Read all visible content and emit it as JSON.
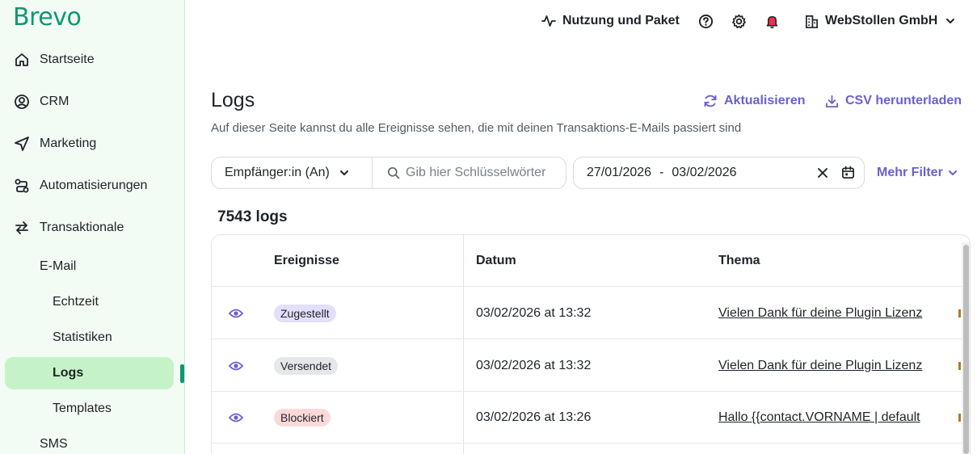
{
  "brand": {
    "logo_text": "Brevo",
    "accent": "#0b996e"
  },
  "sidebar": {
    "items": [
      {
        "label": "Startseite",
        "icon": "home-icon"
      },
      {
        "label": "CRM",
        "icon": "user-circle-icon"
      },
      {
        "label": "Marketing",
        "icon": "send-icon"
      },
      {
        "label": "Automatisierungen",
        "icon": "workflow-icon"
      },
      {
        "label": "Transaktionale",
        "icon": "swap-arrows-icon"
      }
    ],
    "sub": {
      "label": "E-Mail"
    },
    "sub2": [
      {
        "label": "Echtzeit"
      },
      {
        "label": "Statistiken"
      },
      {
        "label": "Logs",
        "active": true
      },
      {
        "label": "Templates"
      }
    ],
    "sms": {
      "label": "SMS"
    }
  },
  "topbar": {
    "usage_label": "Nutzung und Paket",
    "company_label": "WebStollen GmbH"
  },
  "page": {
    "title": "Logs",
    "description": "Auf dieser Seite kannst du alle Ereignisse sehen, die mit deinen Transaktions-E-Mails passiert sind",
    "refresh_label": "Aktualisieren",
    "csv_label": "CSV herunterladen",
    "accent": "#6b5fd3"
  },
  "filters": {
    "recipient_label": "Empfänger:in (An)",
    "search_placeholder": "Gib hier Schlüsselwörter",
    "date_from": "27/01/2026",
    "date_sep": "-",
    "date_to": "03/02/2026",
    "more_label": "Mehr Filter"
  },
  "logs_count": "7543 logs",
  "table": {
    "headers": {
      "events": "Ereignisse",
      "date": "Datum",
      "subject": "Thema"
    },
    "rows": [
      {
        "event": "Zugestellt",
        "event_color": "#e3defa",
        "date": "03/02/2026 at 13:32",
        "subject": "Vielen Dank für deine Plugin Lizenz"
      },
      {
        "event": "Versendet",
        "event_color": "#e6e7e9",
        "date": "03/02/2026 at 13:32",
        "subject": "Vielen Dank für deine Plugin Lizenz"
      },
      {
        "event": "Blockiert",
        "event_color": "#fbd9d9",
        "date": "03/02/2026 at 13:26",
        "subject": "Hallo {{contact.VORNAME | default"
      }
    ]
  }
}
